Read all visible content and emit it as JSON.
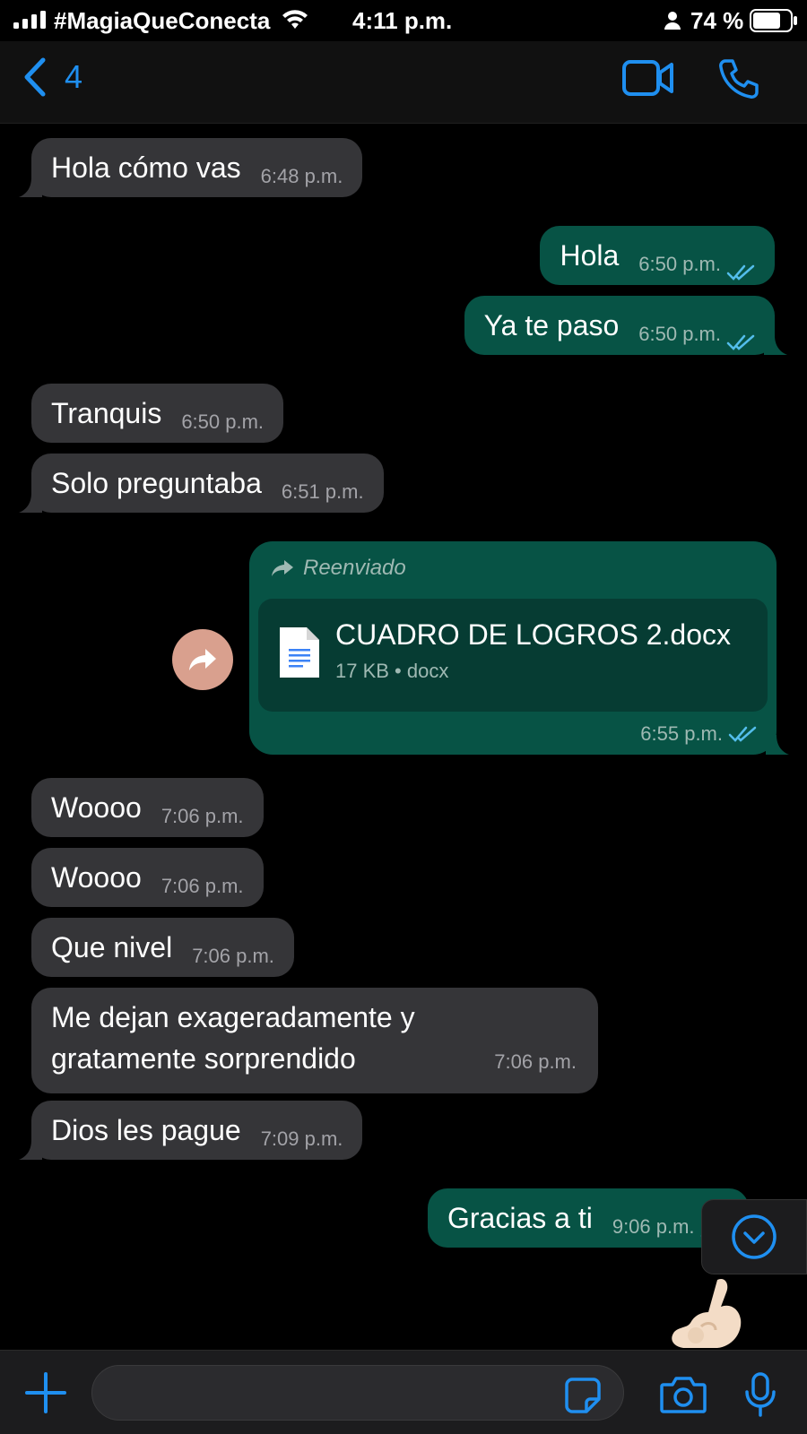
{
  "status_bar": {
    "carrier": "#MagiaQueConecta",
    "time": "4:11 p.m.",
    "battery": "74 %"
  },
  "header": {
    "back_count": "4",
    "icons": [
      "back-chevron-icon",
      "video-camera-icon",
      "phone-icon"
    ]
  },
  "messages": [
    {
      "dir": "in",
      "text": "Hola cómo vas",
      "time": "6:48 p.m."
    },
    {
      "dir": "out",
      "text": "Hola",
      "time": "6:50 p.m.",
      "read": true
    },
    {
      "dir": "out",
      "text": "Ya te paso",
      "time": "6:50 p.m.",
      "read": true
    },
    {
      "dir": "in",
      "text": "Tranquis",
      "time": "6:50 p.m."
    },
    {
      "dir": "in",
      "text": "Solo preguntaba",
      "time": "6:51 p.m."
    },
    {
      "dir": "in",
      "text": "Woooo",
      "time": "7:06 p.m."
    },
    {
      "dir": "in",
      "text": "Woooo",
      "time": "7:06 p.m."
    },
    {
      "dir": "in",
      "text": "Que nivel",
      "time": "7:06 p.m."
    },
    {
      "dir": "in",
      "text_line1": "Me dejan exageradamente y",
      "text_line2": "gratamente sorprendido",
      "time": "7:06 p.m."
    },
    {
      "dir": "in",
      "text": "Dios les pague",
      "time": "7:09 p.m."
    },
    {
      "dir": "out",
      "text": "Gracias a ti",
      "time": "9:06 p.m.",
      "read": true
    }
  ],
  "forwarded": {
    "label": "Reenviado",
    "file_name": "CUADRO DE LOGROS 2.docx",
    "file_meta": "17 KB • docx",
    "time": "6:55 p.m."
  },
  "colors": {
    "accent": "#1f8ff0",
    "incoming_bubble": "#353538",
    "outgoing_bubble": "#075345",
    "read_ticks": "#53bdeb"
  }
}
